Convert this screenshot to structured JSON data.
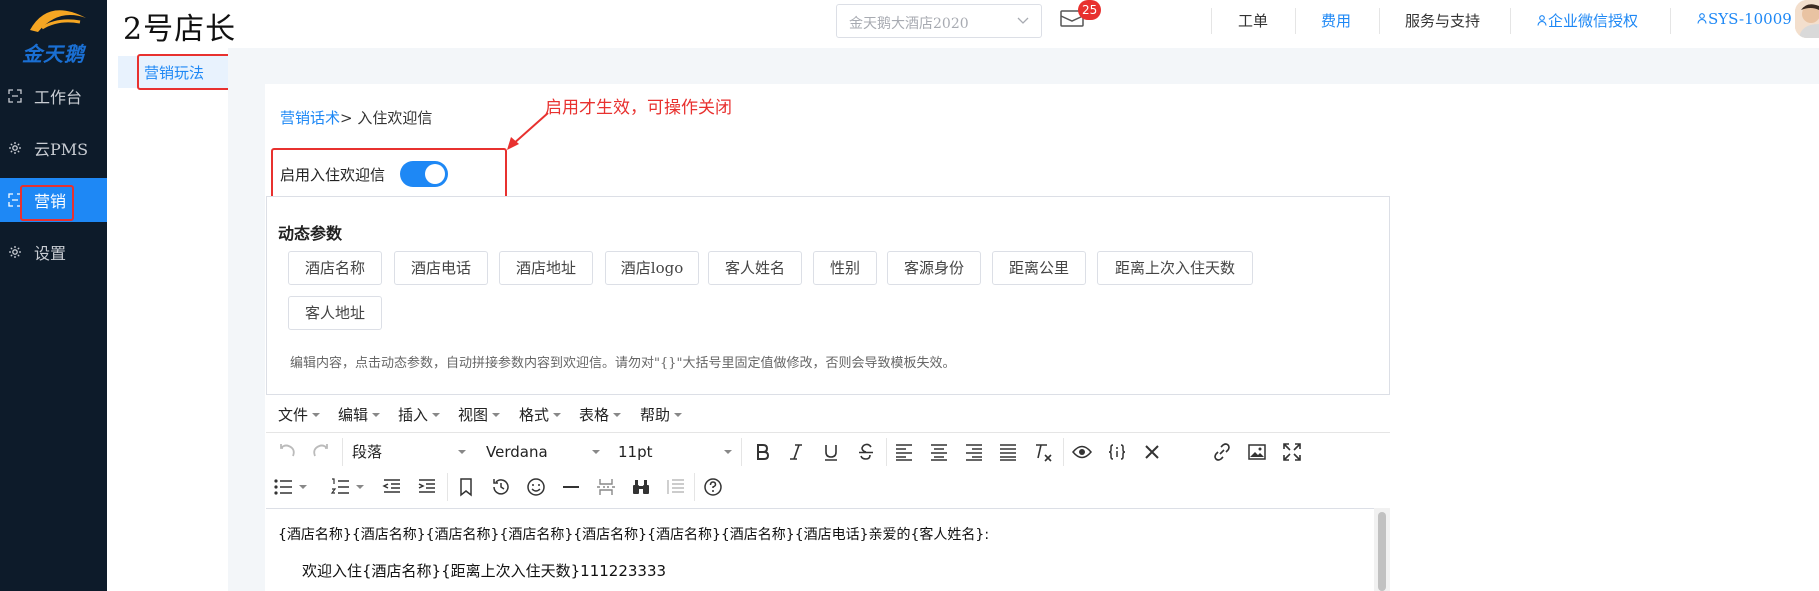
{
  "logo": {
    "text": "金天鹅",
    "color": "#1a6fd3",
    "arc_color": "#f5a623"
  },
  "sidebar": {
    "items": [
      {
        "label": "工作台",
        "icon": "workbench-icon"
      },
      {
        "label": "云PMS",
        "icon": "gear-icon"
      },
      {
        "label": "营销",
        "icon": "marketing-icon",
        "active": true
      },
      {
        "label": "设置",
        "icon": "gear-icon"
      }
    ]
  },
  "header": {
    "brand": "2号店长",
    "hotel_select": {
      "value": "金天鹅大酒店2020"
    },
    "mail_badge": "25",
    "links": {
      "ticket": "工单",
      "fee": "费用",
      "support": "服务与支持",
      "wechat": "企业微信授权",
      "user": "SYS-10009"
    }
  },
  "subside": {
    "item": "营销玩法"
  },
  "breadcrumb": {
    "parent": "营销话术",
    "separator": ">",
    "current": "入住欢迎信"
  },
  "annotation": "启用才生效，可操作关闭",
  "toggle": {
    "label": "启用入住欢迎信",
    "on": true
  },
  "params": {
    "title": "动态参数",
    "chips": [
      "酒店名称",
      "酒店电话",
      "酒店地址",
      "酒店logo",
      "客人姓名",
      "性别",
      "客源身份",
      "距离公里",
      "距离上次入住天数",
      "客人地址"
    ],
    "hint": "编辑内容，点击动态参数，自动拼接参数内容到欢迎信。请勿对\"{}\"大括号里固定值做修改，否则会导致模板失效。"
  },
  "editor": {
    "menus": [
      "文件",
      "编辑",
      "插入",
      "视图",
      "格式",
      "表格",
      "帮助"
    ],
    "format_select": "段落",
    "font_select": "Verdana",
    "size_select": "11pt",
    "line1": "{酒店名称}{酒店名称}{酒店名称}{酒店名称}{酒店名称}{酒店名称}{酒店名称}{酒店电话}亲爱的{客人姓名}:",
    "line2": "欢迎入住{酒店名称}{距离上次入住天数}111223333"
  },
  "colors": {
    "accent": "#1e88f5",
    "annotation_red": "#e8312f",
    "sidebar_bg": "#0d1b2a"
  }
}
